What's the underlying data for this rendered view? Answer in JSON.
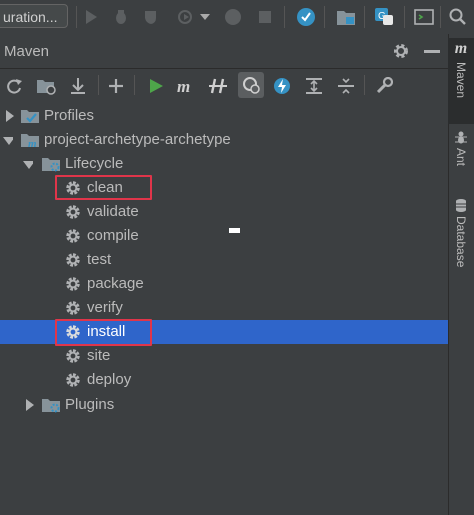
{
  "toolbar": {
    "config_label": "uration..."
  },
  "tool_window": {
    "title": "Maven"
  },
  "right_stripe": {
    "maven_label": "Maven",
    "ant_label": "Ant",
    "database_label": "Database"
  },
  "tree": {
    "profiles": "Profiles",
    "project": "project-archetype-archetype",
    "lifecycle": "Lifecycle",
    "phases": [
      "clean",
      "validate",
      "compile",
      "test",
      "package",
      "verify",
      "install",
      "site",
      "deploy"
    ],
    "selected_phase": "install",
    "highlighted_phases": [
      "clean",
      "install"
    ],
    "plugins": "Plugins"
  },
  "colors": {
    "background": "#3c3f41",
    "selection": "#2f65ca",
    "highlight_box": "#e0354a",
    "gear": "#afb1b3",
    "folder": "#87939a",
    "run_green": "#4ea54a",
    "update_blue": "#3592c4"
  }
}
